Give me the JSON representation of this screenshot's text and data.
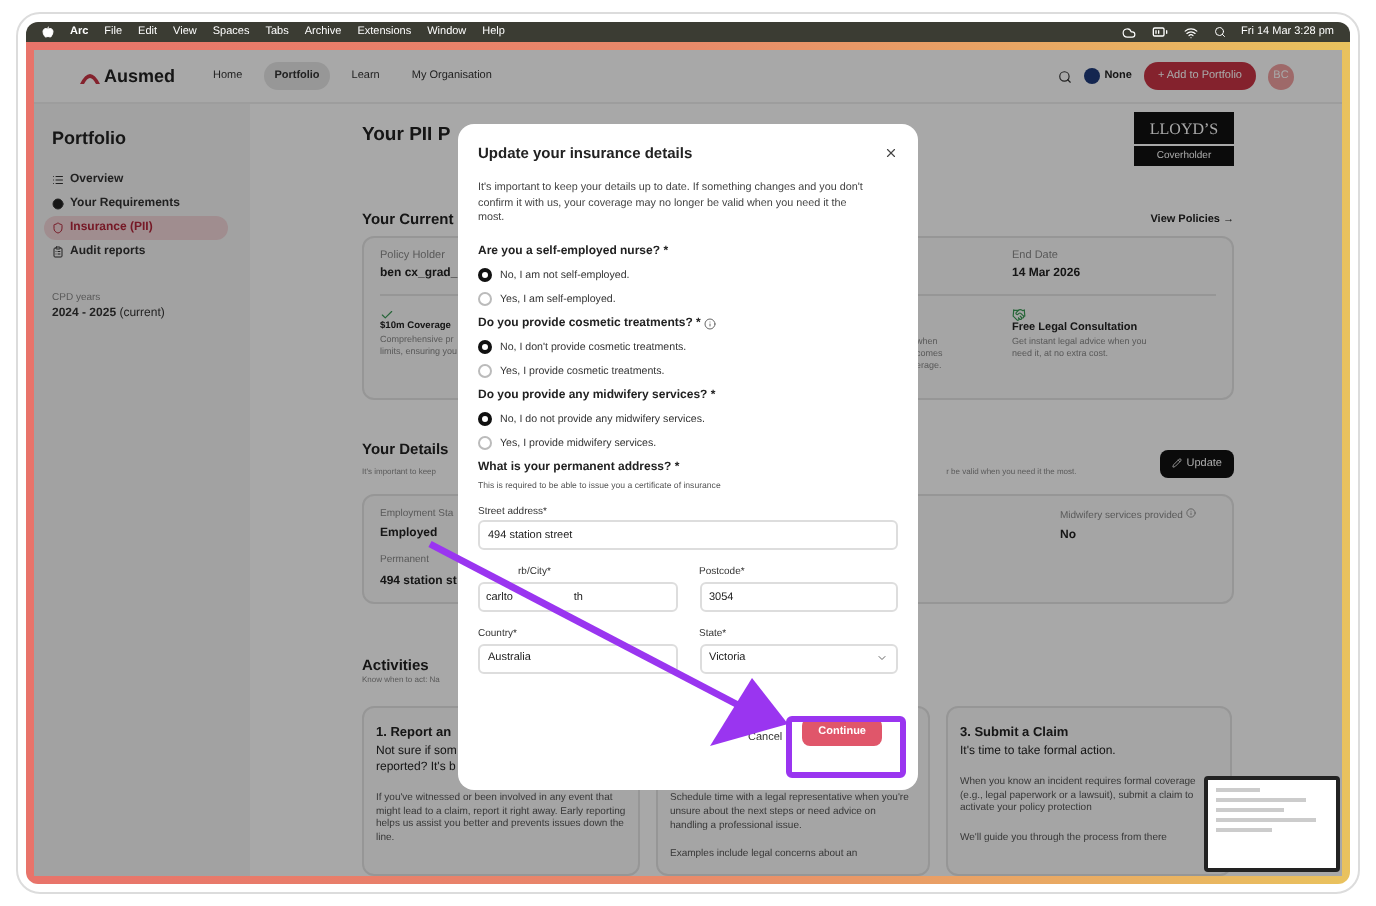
{
  "menubar": {
    "app": "Arc",
    "menus": [
      "File",
      "Edit",
      "View",
      "Spaces",
      "Tabs",
      "Archive",
      "Extensions",
      "Window",
      "Help"
    ],
    "clock": "Fri 14 Mar 3:28 pm"
  },
  "header": {
    "logo": "Ausmed",
    "nav": [
      {
        "label": "Home",
        "selected": false
      },
      {
        "label": "Portfolio",
        "selected": true
      },
      {
        "label": "Learn",
        "selected": false
      },
      {
        "label": "My Organisation",
        "selected": false
      }
    ],
    "organisation": "None",
    "add_button": "+ Add to Portfolio",
    "avatar": "BC"
  },
  "sidebar": {
    "title": "Portfolio",
    "items": [
      {
        "label": "Overview",
        "selected": false
      },
      {
        "label": "Your Requirements",
        "selected": false
      },
      {
        "label": "Insurance (PII)",
        "selected": true
      },
      {
        "label": "Audit reports",
        "selected": false
      }
    ],
    "cpd_label": "CPD years",
    "cpd_value": "**2024 - 2025** (current)"
  },
  "policy": {
    "title": "Your PII P",
    "insurer_logo": {
      "name": "LLOYD’S",
      "subtitle": "Coverholder"
    },
    "current_heading": "Your Current",
    "view_link": "View Policies →",
    "holder_label": "Policy Holder",
    "holder_value": "ben cx_grad_",
    "end_label": "End Date",
    "end_value": "14 Mar 2026",
    "coverage": {
      "title": "$10m Coverage",
      "lines": [
        "Comprehensive pr",
        "limits, ensuring you"
      ]
    },
    "hidden_feature_lines": [
      "when",
      "comes",
      "erage."
    ],
    "legal": {
      "title": "Free Legal Consultation",
      "text": "Get instant legal advice when you need it, at no extra cost."
    }
  },
  "details": {
    "heading": "Your Details",
    "intro": "It's important to keep",
    "intro_end": "r be valid when you need it the most.",
    "update_button": "Update",
    "fields": [
      {
        "label": "Employment Sta",
        "value": "Employed"
      },
      {
        "label": "Permanent",
        "value": "494 station st"
      }
    ],
    "midwifery_label": "Midwifery services provided",
    "midwifery_value": "No"
  },
  "activities": {
    "heading": "Activities",
    "intro": "Know when to act: Na",
    "cards": [
      {
        "title": "1. Report an",
        "subtitle_lines": [
          "Not sure if som",
          "reported? It's b"
        ],
        "paragraphs": [
          "If you've witnessed or been involved in any event that might lead to a claim, report it right away. Early reporting helps us assist you better and prevents issues down the line."
        ]
      },
      {
        "paragraphs": [
          "Schedule time with a legal representative when you're unsure about the next steps or need advice on handling a professional issue.",
          "Examples include legal concerns about an"
        ]
      },
      {
        "title": "3. Submit a Claim",
        "subtitle_lines": [
          "It's time to take formal action."
        ],
        "paragraphs": [
          "When you know an incident requires formal coverage (e.g., legal paperwork or a lawsuit), submit a claim to activate your policy protection",
          "We'll guide you through the process from there"
        ]
      }
    ]
  },
  "modal": {
    "title": "Update your insurance details",
    "intro": "It's important to keep your details up to date. If something changes and you don't confirm it with us, your coverage may no longer be valid when you need it the most.",
    "questions": [
      {
        "text": "Are you a self-employed nurse? *",
        "info": false,
        "options": [
          {
            "label": "No, I am not self-employed.",
            "selected": true
          },
          {
            "label": "Yes, I am self-employed.",
            "selected": false
          }
        ]
      },
      {
        "text": "Do you provide cosmetic treatments? *",
        "info": true,
        "options": [
          {
            "label": "No, I don't provide cosmetic treatments.",
            "selected": true
          },
          {
            "label": "Yes, I provide cosmetic treatments.",
            "selected": false
          }
        ]
      },
      {
        "text": "Do you provide any midwifery services? *",
        "info": false,
        "options": [
          {
            "label": "No, I do not provide any midwifery services.",
            "selected": true
          },
          {
            "label": "Yes, I provide midwifery services.",
            "selected": false
          }
        ]
      }
    ],
    "address": {
      "heading": "What is your permanent address? *",
      "hint": "This is required to be able to issue you a certificate of insurance",
      "fields": [
        {
          "label": "Street address*",
          "value": "494 station street",
          "kind": "text",
          "wide": true
        },
        {
          "label": "rb/City*",
          "parts": [
            "carlto",
            "th"
          ],
          "kind": "split",
          "wide": false
        },
        {
          "label": "Postcode*",
          "value": "3054",
          "kind": "text",
          "wide": false
        },
        {
          "label": "Country*",
          "value": "Australia",
          "kind": "text",
          "wide": false
        },
        {
          "label": "State*",
          "value": "Victoria",
          "kind": "select",
          "wide": false
        }
      ]
    },
    "cancel": "Cancel",
    "continue": "Continue"
  }
}
